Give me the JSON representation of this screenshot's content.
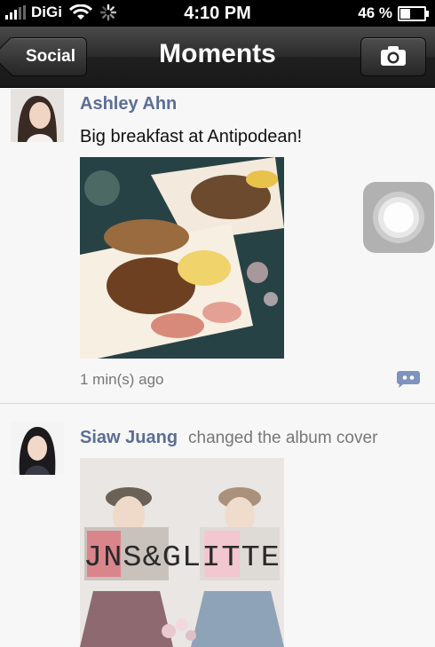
{
  "status_bar": {
    "carrier": "DiGi",
    "time": "4:10 PM",
    "battery_percent": "46 %",
    "battery_level": 0.46
  },
  "nav": {
    "back_label": "Social",
    "title": "Moments",
    "camera_icon": "camera-icon"
  },
  "posts": [
    {
      "author": "Ashley Ahn",
      "action": "",
      "text": "Big breakfast at Antipodean!",
      "timestamp": "1 min(s) ago",
      "photo_icon": "food-photo"
    },
    {
      "author": "Siaw Juang",
      "action": "changed the album cover",
      "photo_caption": "JNS&GLITTE",
      "photo_icon": "album-cover-photo"
    }
  ],
  "colors": {
    "author_name": "#5b6e96",
    "navbar": "#1f1f1f",
    "background": "#f7f7f7"
  }
}
